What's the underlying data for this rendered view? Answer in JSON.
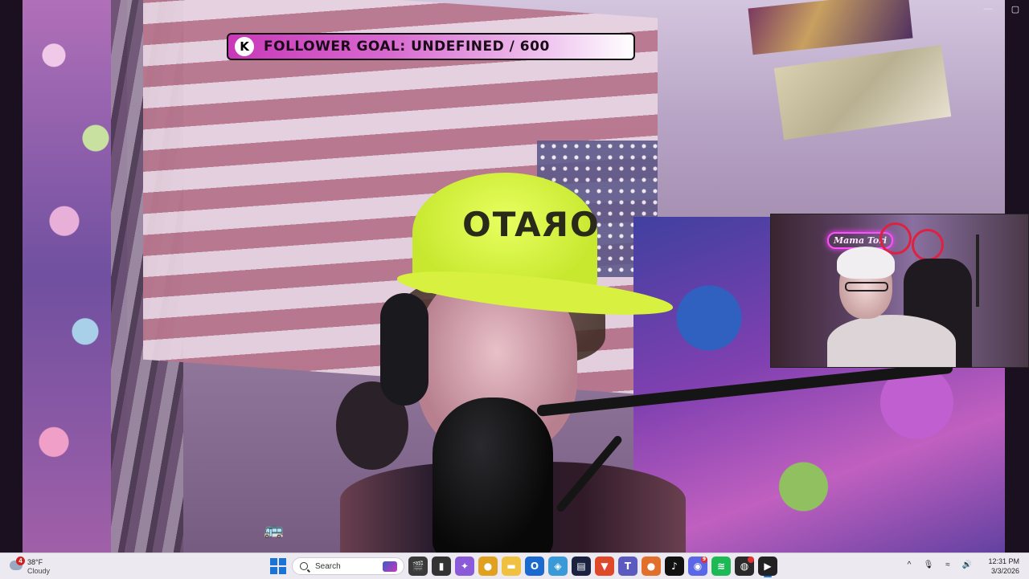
{
  "overlay": {
    "goal_logo": "K",
    "goal_text": "FOLLOWER GOAL: UNDEFINED / 600"
  },
  "main_video": {
    "cap_text": "ORATO"
  },
  "inset_webcam": {
    "neon_sign": "Mama Tori"
  },
  "window_controls": {
    "minimize": "—",
    "maximize": "▢"
  },
  "taskbar": {
    "weather": {
      "badge": "4",
      "temperature": "38°F",
      "condition": "Cloudy"
    },
    "search_placeholder": "Search",
    "apps": [
      {
        "name": "clapper-icon",
        "glyph": "🎬",
        "color": "#3a3a3a"
      },
      {
        "name": "terminal-icon",
        "glyph": "▮",
        "color": "#333333"
      },
      {
        "name": "copilot-icon",
        "glyph": "✦",
        "color": "#8a5ad8"
      },
      {
        "name": "chrome-icon",
        "glyph": "●",
        "color": "#e0a020"
      },
      {
        "name": "file-explorer-icon",
        "glyph": "▬",
        "color": "#f0c040"
      },
      {
        "name": "outlook-icon",
        "glyph": "O",
        "color": "#1a6ad0"
      },
      {
        "name": "photos-icon",
        "glyph": "◈",
        "color": "#3a9ad8"
      },
      {
        "name": "app-dark-icon",
        "glyph": "▤",
        "color": "#1a2240"
      },
      {
        "name": "brave-icon",
        "glyph": "▼",
        "color": "#e0482a"
      },
      {
        "name": "teams-icon",
        "glyph": "T",
        "color": "#5a5ac0"
      },
      {
        "name": "firefox-icon",
        "glyph": "●",
        "color": "#e0702a"
      },
      {
        "name": "tiktok-icon",
        "glyph": "♪",
        "color": "#111111"
      },
      {
        "name": "discord-icon",
        "glyph": "◉",
        "color": "#5a68e8",
        "badge": "9"
      },
      {
        "name": "spotify-icon",
        "glyph": "≋",
        "color": "#1db954"
      },
      {
        "name": "obs-icon",
        "glyph": "◍",
        "color": "#2a2a2a",
        "badge": " "
      },
      {
        "name": "media-player-icon",
        "glyph": "▶",
        "color": "#222222",
        "active": true
      }
    ],
    "tray": {
      "chevron": "^",
      "mic": "🎙",
      "wifi": "≈",
      "volume": "🔊"
    },
    "clock": {
      "time": "12:31 PM",
      "date": "3/3/2026"
    }
  }
}
